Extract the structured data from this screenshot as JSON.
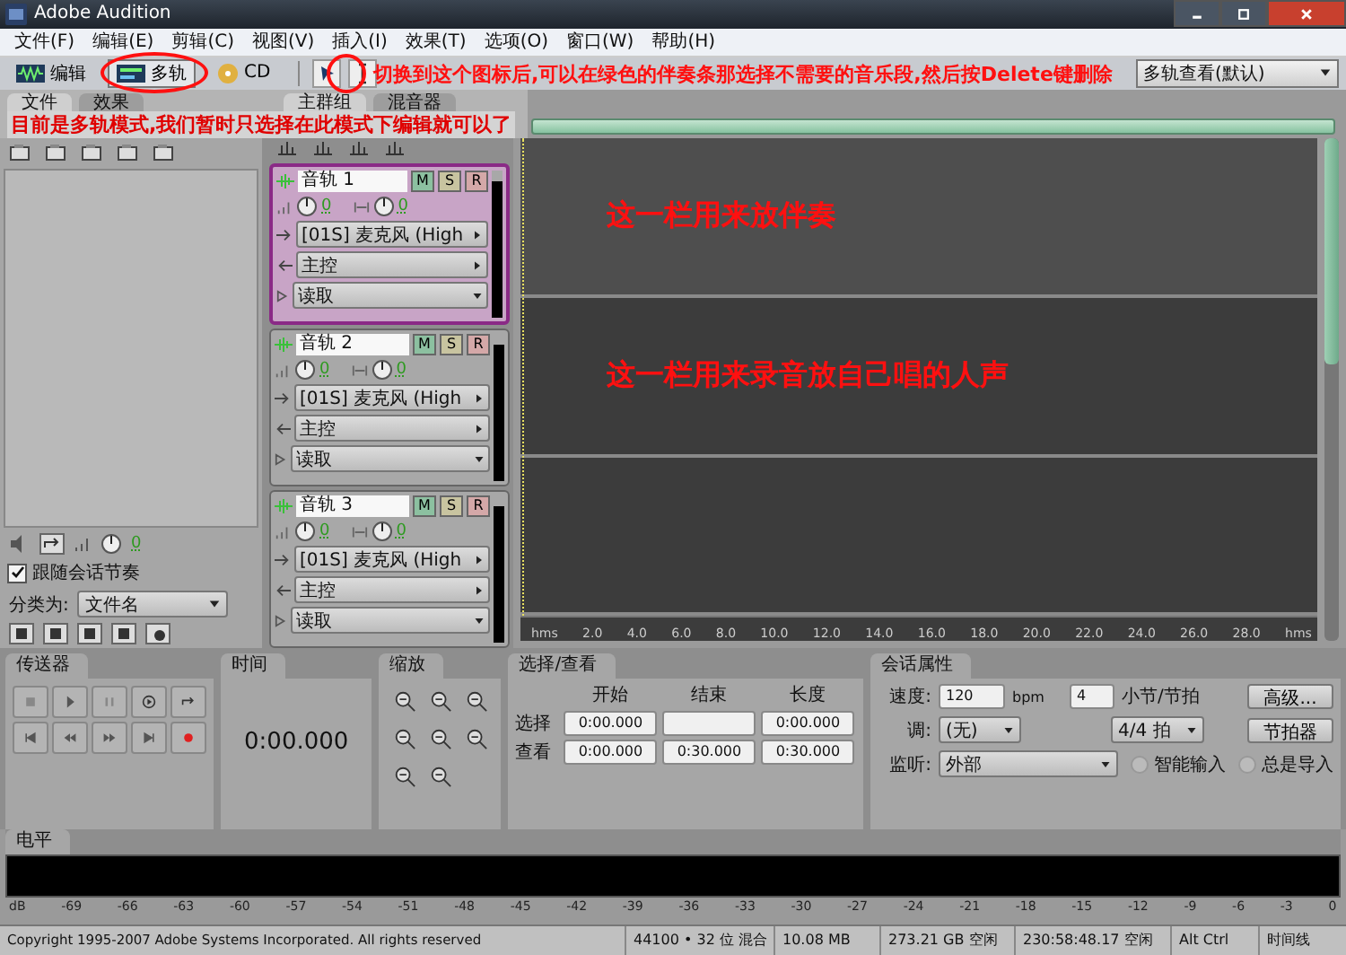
{
  "window": {
    "title": "Adobe Audition"
  },
  "menu": [
    "文件(F)",
    "编辑(E)",
    "剪辑(C)",
    "视图(V)",
    "插入(I)",
    "效果(T)",
    "选项(O)",
    "窗口(W)",
    "帮助(H)"
  ],
  "toolbar": {
    "modes": [
      {
        "label": "编辑",
        "selected": false
      },
      {
        "label": "多轨",
        "selected": true
      },
      {
        "label": "CD",
        "selected": false
      }
    ],
    "workspace": "多轨查看(默认)"
  },
  "notes": {
    "tool_note": "切换到这个图标后,可以在绿色的伴奏条那选择不需要的音乐段,然后按Delete键删除",
    "mode_note": "目前是多轨模式,我们暂时只选择在此模式下编辑就可以了"
  },
  "left_tabs": [
    {
      "label": "文件",
      "selected": true
    },
    {
      "label": "效果",
      "selected": false
    }
  ],
  "files_panel": {
    "volume": "0",
    "follow_tempo": {
      "label": "跟随会话节奏",
      "checked": true
    },
    "sort_label": "分类为:",
    "sort_value": "文件名"
  },
  "main_tabs": [
    {
      "label": "主群组",
      "selected": true
    },
    {
      "label": "混音器",
      "selected": false
    }
  ],
  "tracks": [
    {
      "name": "音轨 1",
      "selected": true,
      "buttons": [
        "M",
        "S",
        "R"
      ],
      "volume": "0",
      "pan": "0",
      "input": "[01S] 麦克风 (High",
      "output": "主控",
      "automation": "读取",
      "note": "这一栏用来放伴奏"
    },
    {
      "name": "音轨 2",
      "selected": false,
      "buttons": [
        "M",
        "S",
        "R"
      ],
      "volume": "0",
      "pan": "0",
      "input": "[01S] 麦克风 (High",
      "output": "主控",
      "automation": "读取",
      "note": "这一栏用来录音放自己唱的人声"
    },
    {
      "name": "音轨 3",
      "selected": false,
      "buttons": [
        "M",
        "S",
        "R"
      ],
      "volume": "0",
      "pan": "0",
      "input": "[01S] 麦克风 (High",
      "output": "主控",
      "automation": "读取"
    }
  ],
  "ruler": [
    "hms",
    "2.0",
    "4.0",
    "6.0",
    "8.0",
    "10.0",
    "12.0",
    "14.0",
    "16.0",
    "18.0",
    "20.0",
    "22.0",
    "24.0",
    "26.0",
    "28.0",
    "hms"
  ],
  "transport": {
    "title": "传送器"
  },
  "time": {
    "title": "时间",
    "value": "0:00.000"
  },
  "zoom": {
    "title": "缩放"
  },
  "selection": {
    "title": "选择/查看",
    "columns": [
      "开始",
      "结束",
      "长度"
    ],
    "rows": [
      {
        "label": "选择",
        "start": "0:00.000",
        "length": "0:00.000"
      },
      {
        "label": "查看",
        "start": "0:00.000",
        "end": "0:30.000",
        "length": "0:30.000"
      }
    ]
  },
  "session": {
    "title": "会话属性",
    "tempo_label": "速度:",
    "tempo": "120",
    "tempo_unit": "bpm",
    "beats": "4",
    "beats_label": "小节/节拍",
    "key_label": "调:",
    "key": "(无)",
    "time_signature": "4/4 拍",
    "monitor_label": "监听:",
    "monitor": "外部",
    "options": [
      {
        "label": "智能输入",
        "selected": false
      },
      {
        "label": "总是导入",
        "selected": false
      }
    ],
    "buttons": [
      "高级...",
      "节拍器"
    ]
  },
  "meter": {
    "title": "电平",
    "scale": [
      "dB",
      "-69",
      "-66",
      "-63",
      "-60",
      "-57",
      "-54",
      "-51",
      "-48",
      "-45",
      "-42",
      "-39",
      "-36",
      "-33",
      "-30",
      "-27",
      "-24",
      "-21",
      "-18",
      "-15",
      "-12",
      "-9",
      "-6",
      "-3",
      "0"
    ]
  },
  "status_bar": [
    "Copyright 1995-2007 Adobe Systems Incorporated. All rights reserved",
    "44100 • 32 位 混合",
    "10.08 MB",
    "273.21 GB 空闲",
    "230:58:48.17 空闲",
    "Alt Ctrl",
    "时间线"
  ]
}
